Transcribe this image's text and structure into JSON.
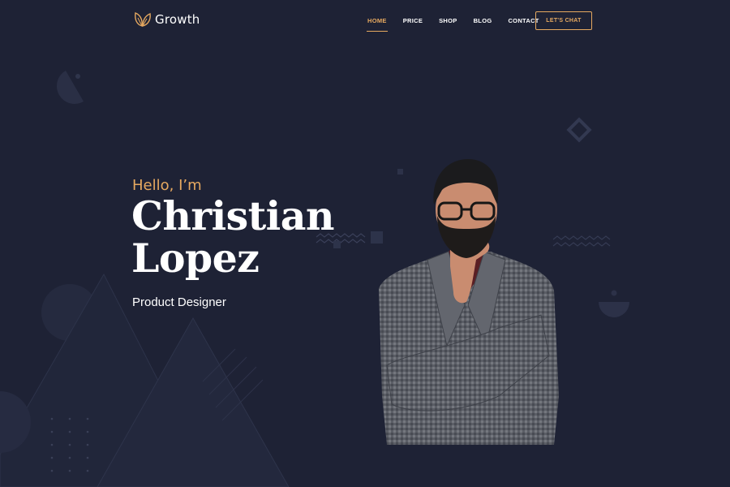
{
  "brand": {
    "name": "Growth",
    "accent_color": "#e6a960",
    "background_color": "#1e2235",
    "icon": "leaves-logo-icon"
  },
  "nav": {
    "items": [
      {
        "label": "HOME",
        "active": true
      },
      {
        "label": "PRICE",
        "active": false
      },
      {
        "label": "SHOP",
        "active": false
      },
      {
        "label": "BLOG",
        "active": false
      },
      {
        "label": "CONTACT",
        "active": false
      }
    ],
    "cta_label": "LET'S CHAT"
  },
  "hero": {
    "greeting": "Hello, I’m",
    "first_name": "Christian",
    "last_name": "Lopez",
    "role": "Product Designer",
    "image": "portrait-photo"
  }
}
